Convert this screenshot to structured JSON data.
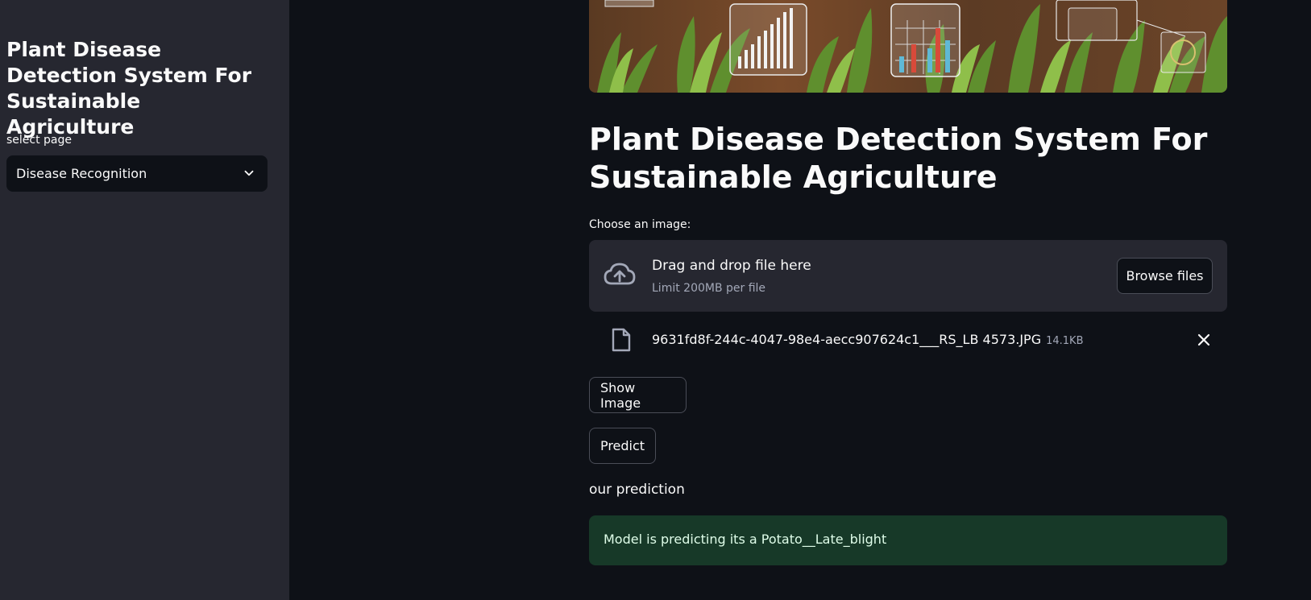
{
  "sidebar": {
    "title": "Plant Disease Detection System For Sustainable Agriculture",
    "select_label": "select page",
    "select_value": "Disease Recognition",
    "select_icon": "chevron-down-icon"
  },
  "main": {
    "title": "Plant Disease Detection System For Sustainable Agriculture",
    "uploader": {
      "label": "Choose an image:",
      "drop_title": "Drag and drop file here",
      "limit_text": "Limit 200MB per file",
      "browse_label": "Browse files",
      "icon": "cloud-upload-icon"
    },
    "file": {
      "name": "9631fd8f-244c-4047-98e4-aecc907624c1___RS_LB 4573.JPG",
      "size": "14.1KB",
      "icon": "file-icon",
      "close_icon": "close-icon"
    },
    "show_image_label": "Show Image",
    "predict_label": "Predict",
    "prediction_label": "our prediction",
    "result_text": "Model is predicting its a Potato__Late_blight"
  },
  "colors": {
    "background": "#0e1117",
    "sidebar": "#262730",
    "success_bg": "#173928",
    "success_text": "#dffde9"
  }
}
